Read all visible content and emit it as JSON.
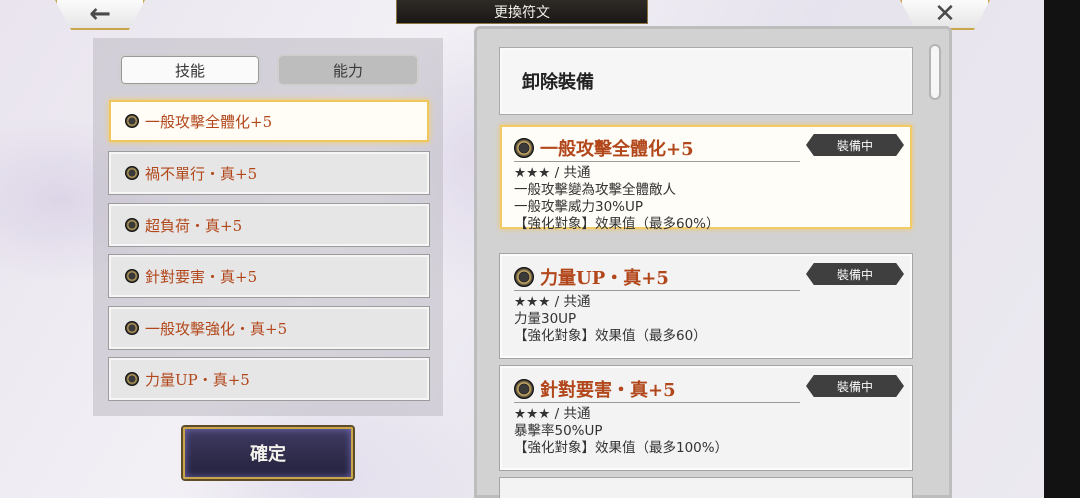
{
  "header": {
    "title": "更換符文",
    "back_icon": "←",
    "close_icon": "✕"
  },
  "tabs": [
    {
      "label": "技能",
      "active": true
    },
    {
      "label": "能力",
      "active": false
    }
  ],
  "skill_list": [
    {
      "label": "一般攻擊全體化+5",
      "selected": true
    },
    {
      "label": "禍不單行・真+5",
      "selected": false
    },
    {
      "label": "超負荷・真+5",
      "selected": false
    },
    {
      "label": "針對要害・真+5",
      "selected": false
    },
    {
      "label": "一般攻擊強化・真+5",
      "selected": false
    },
    {
      "label": "力量UP・真+5",
      "selected": false
    }
  ],
  "confirm_label": "確定",
  "unequip_label": "卸除裝備",
  "equipped_cards": [
    {
      "name": "一般攻擊全體化+5",
      "badge": "裝備中",
      "meta": "★★★ / 共通",
      "lines": [
        "一般攻擊變為攻擊全體敵人",
        "一般攻擊威力30%UP",
        "【強化對象】效果值（最多60%）"
      ],
      "selected": true
    },
    {
      "name": "力量UP・真+5",
      "badge": "裝備中",
      "meta": "★★★ / 共通",
      "lines": [
        "力量30UP",
        "【強化對象】效果值（最多60）"
      ],
      "selected": false
    },
    {
      "name": "針對要害・真+5",
      "badge": "裝備中",
      "meta": "★★★ / 共通",
      "lines": [
        "暴擊率50%UP",
        "【強化對象】效果值（最多100%）"
      ],
      "selected": false
    }
  ],
  "colors": {
    "accent_gold": "#f0c75c",
    "skill_text": "#b2471b",
    "badge_bg": "#3f3f3f",
    "confirm_bg": "#2f2c4e"
  },
  "icons": {
    "rune": "rune-icon",
    "back": "back-arrow-icon",
    "close": "close-icon"
  }
}
